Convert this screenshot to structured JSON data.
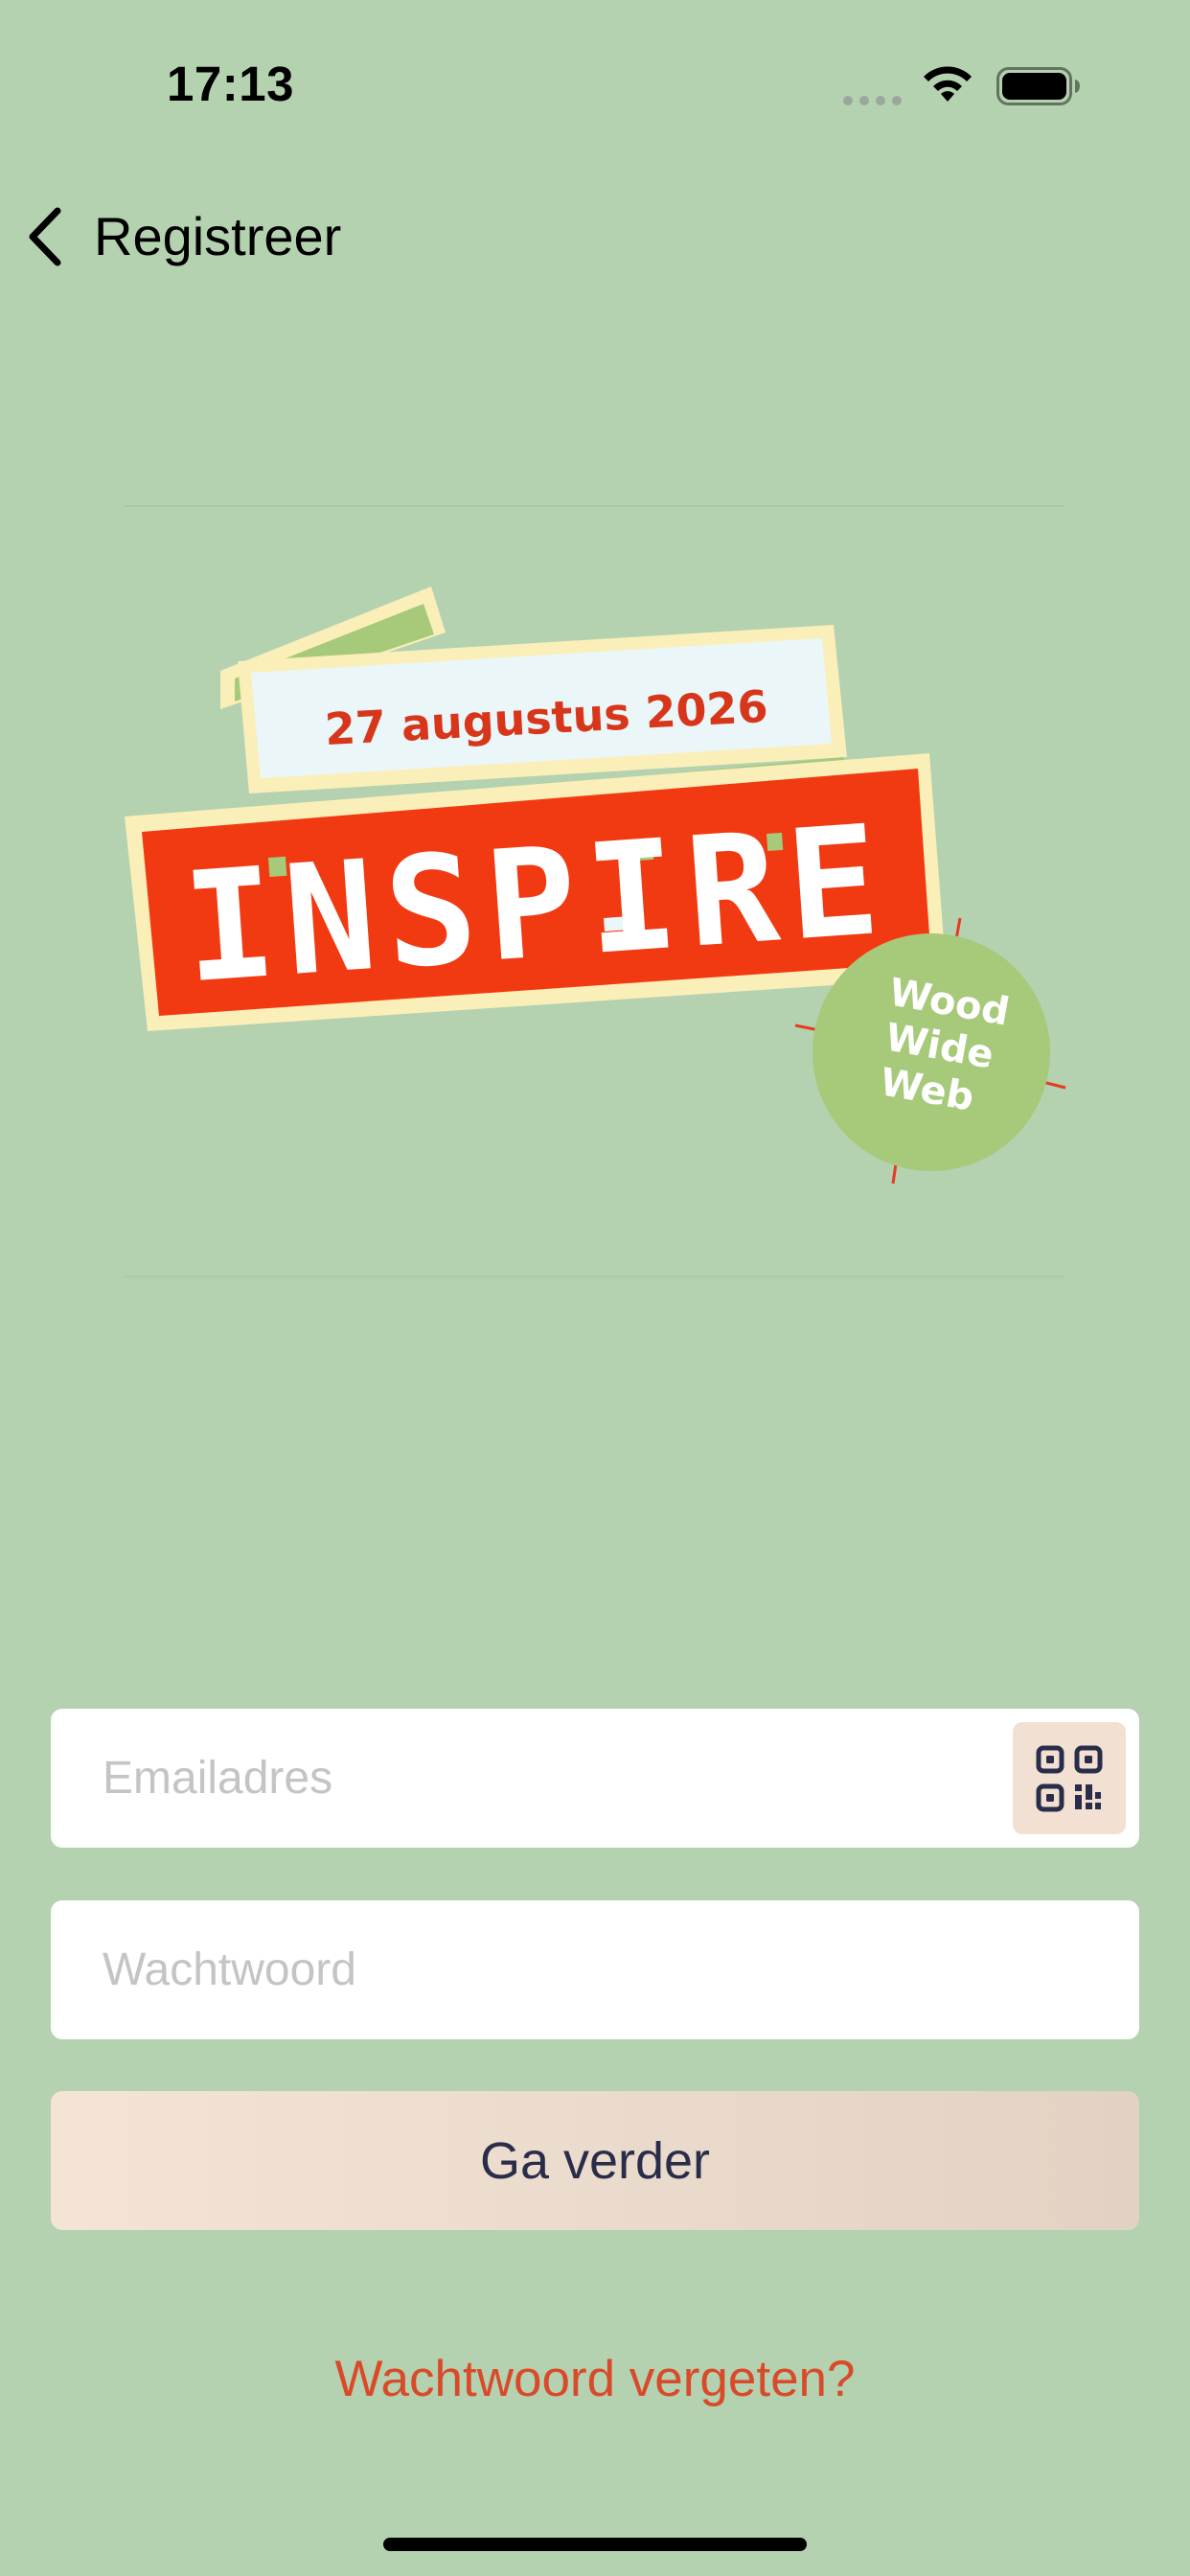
{
  "status_bar": {
    "time": "17:13"
  },
  "nav": {
    "back_label": "Registreer"
  },
  "logo": {
    "date": "27 augustus 2026",
    "title": "INSPIRE",
    "badge_line1": "Wood",
    "badge_line2": "Wide",
    "badge_line3": "Web"
  },
  "form": {
    "email_placeholder": "Emailadres",
    "email_value": "",
    "password_placeholder": "Wachtwoord",
    "password_value": "",
    "continue_label": "Ga verder",
    "forgot_label": "Wachtwoord vergeten?"
  },
  "colors": {
    "background": "#b4d2af",
    "accent_red": "#f23a12",
    "link": "#d94a2a",
    "button_text": "#2a2d4a",
    "badge_green": "#a7c97a"
  },
  "icons": {
    "back": "chevron-left-icon",
    "scan": "qr-code-icon",
    "wifi": "wifi-icon",
    "battery": "battery-icon"
  }
}
